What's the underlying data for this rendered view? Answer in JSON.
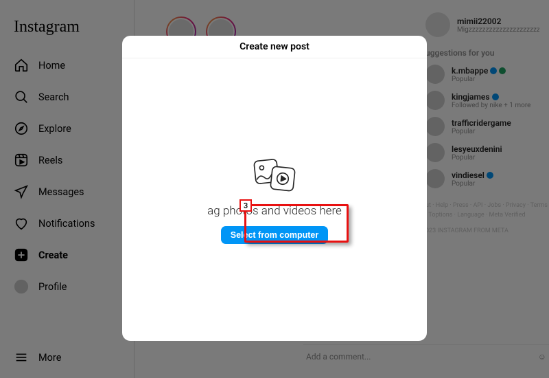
{
  "brand": "Instagram",
  "nav": {
    "home": "Home",
    "search": "Search",
    "explore": "Explore",
    "reels": "Reels",
    "messages": "Messages",
    "notifications": "Notifications",
    "create": "Create",
    "profile": "Profile",
    "more": "More"
  },
  "user": {
    "name": "mimii22002",
    "sub": "Migzzzzzzzzzzzzzzzzzzzzzzzzzzzzzz"
  },
  "suggestions": {
    "title": "uggestions for you",
    "items": [
      {
        "name": "k.mbappe",
        "sub": "Popular",
        "verified": true,
        "extra": true
      },
      {
        "name": "kingjames",
        "sub": "Followed by nike + 1 more",
        "verified": true,
        "extra": false
      },
      {
        "name": "trafficridergame",
        "sub": "Popular",
        "verified": false,
        "extra": false
      },
      {
        "name": "lesyeuxdenini",
        "sub": "Popular",
        "verified": false,
        "extra": false
      },
      {
        "name": "vindiesel",
        "sub": "Popular",
        "verified": true,
        "extra": false
      }
    ]
  },
  "footer": {
    "links": "ut · Help · Press · API · Jobs · Privacy · Terms · Toptions · Language · Meta Verified",
    "copyright": "023 INSTAGRAM FROM META"
  },
  "comment": {
    "placeholder": "Add a comment..."
  },
  "modal": {
    "title": "Create new post",
    "drag": "ag photos and videos here",
    "button": "Select from computer"
  },
  "callout": {
    "num": "3"
  }
}
